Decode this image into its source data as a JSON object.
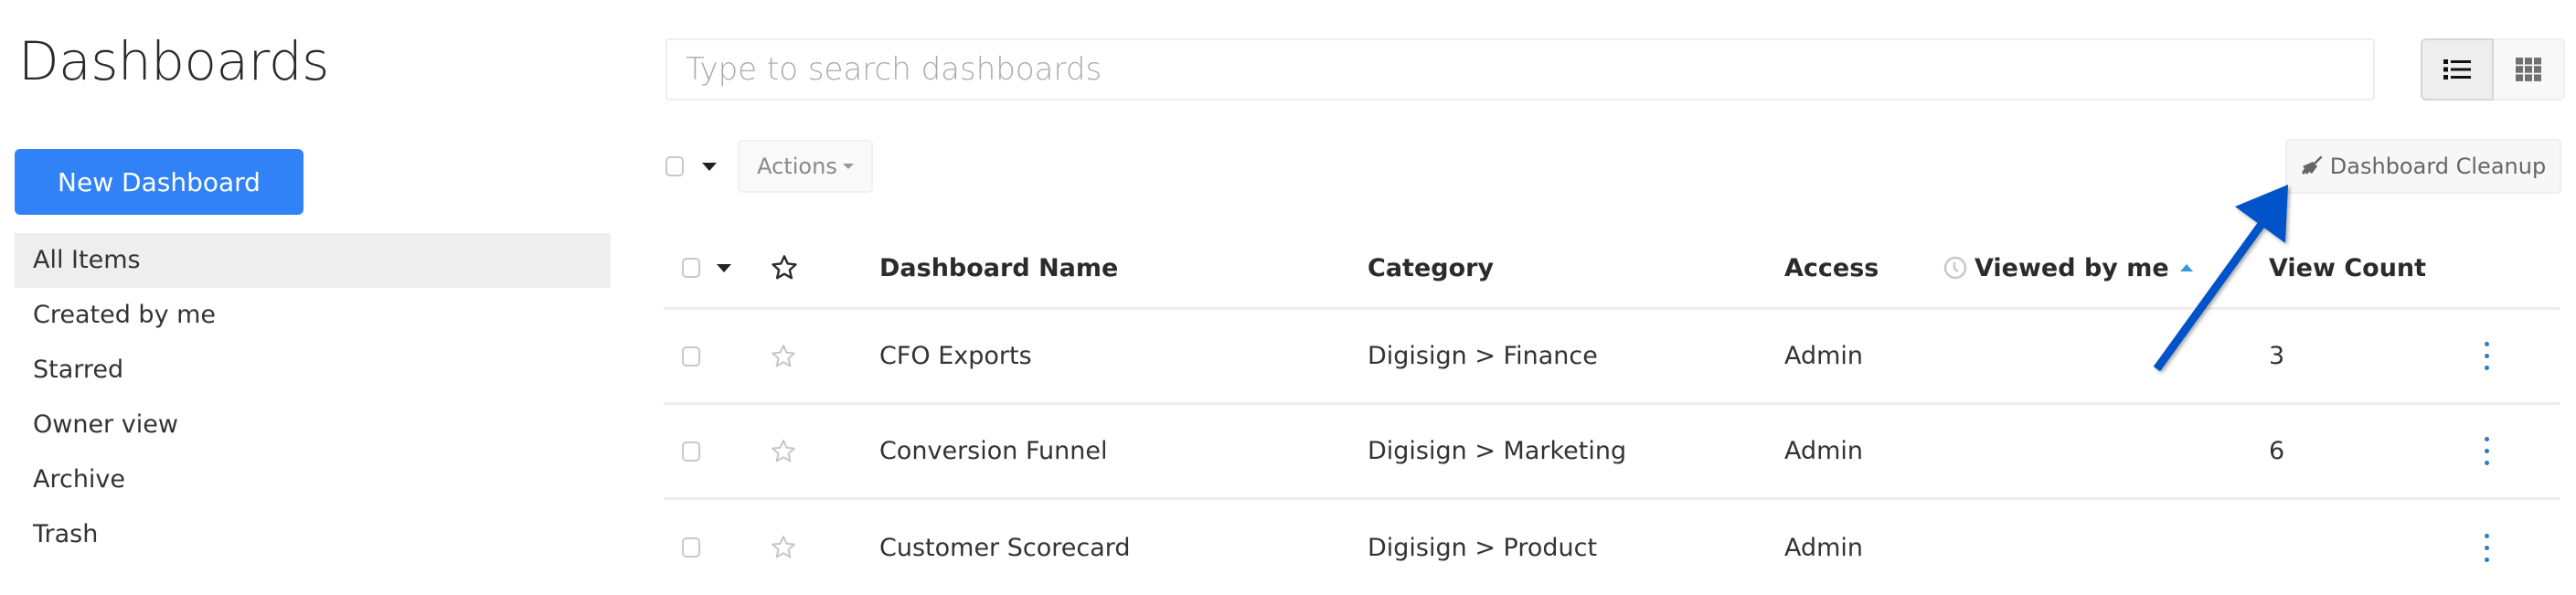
{
  "page": {
    "title": "Dashboards"
  },
  "sidebar": {
    "new_button_label": "New Dashboard",
    "items": [
      {
        "label": "All Items",
        "active": true
      },
      {
        "label": "Created by me"
      },
      {
        "label": "Starred"
      },
      {
        "label": "Owner view"
      },
      {
        "label": "Archive"
      },
      {
        "label": "Trash"
      }
    ]
  },
  "search": {
    "placeholder": "Type to search dashboards",
    "value": ""
  },
  "view_toggle": {
    "options": [
      "list-view",
      "grid-view"
    ],
    "selected": "list-view"
  },
  "toolbar": {
    "actions_label": "Actions",
    "cleanup_label": "Dashboard Cleanup"
  },
  "table": {
    "columns": [
      "Dashboard Name",
      "Category",
      "Access",
      "Viewed by me",
      "View Count"
    ],
    "sort": {
      "column": "Viewed by me",
      "direction": "ascending"
    },
    "rows": [
      {
        "name": "CFO Exports",
        "category": "Digisign > Finance",
        "access": "Admin",
        "viewed": "",
        "count": "3",
        "starred": false
      },
      {
        "name": "Conversion Funnel",
        "category": "Digisign > Marketing",
        "access": "Admin",
        "viewed": "",
        "count": "6",
        "starred": false
      },
      {
        "name": "Customer Scorecard",
        "category": "Digisign > Product",
        "access": "Admin",
        "viewed": "",
        "count": "",
        "starred": false
      }
    ]
  },
  "annotation": {
    "type": "arrow",
    "color": "#0652c8",
    "points_to": "Dashboard Cleanup"
  },
  "colors": {
    "primary": "#3182f6",
    "sort_indicator": "#3a96dd",
    "kebab": "#2f7bbf"
  }
}
